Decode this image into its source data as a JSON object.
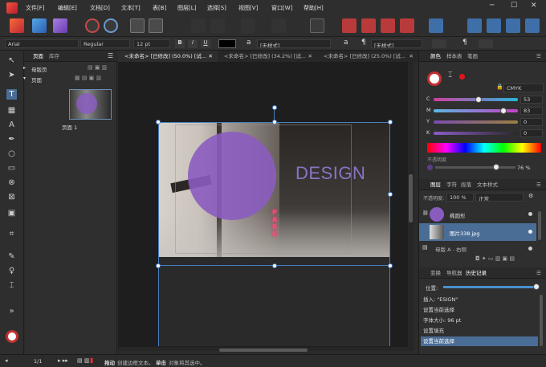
{
  "menu": [
    "文件[F]",
    "编辑[E]",
    "文档[D]",
    "文本[T]",
    "表[B]",
    "图层[L]",
    "选择[S]",
    "视图[V]",
    "窗口[W]",
    "帮助[H]"
  ],
  "context": {
    "font": "Arial",
    "style": "Regular",
    "size": "12 pt",
    "char_style": "[无样式]",
    "para_style": "[无样式]",
    "letter_a": "a",
    "pilcrow": "¶"
  },
  "left_panel": {
    "tab_pages": "页面",
    "tab_library": "库存",
    "master_pages": "母版页",
    "pages": "页面",
    "page_label": "页面 1"
  },
  "doc_tabs": [
    "<未命名> [已修改] (50.0%) [试...",
    "<未命名> [已修改] (34.2%) [试...",
    "<未命名> [已修改] (25.0%) [试..."
  ],
  "canvas": {
    "design_text": "DESIGN",
    "park_text": "PARK"
  },
  "color_panel": {
    "tabs": [
      "颜色",
      "样本表",
      "笔画"
    ],
    "mode": "CMYK",
    "channels": [
      {
        "label": "C",
        "value": 53
      },
      {
        "label": "M",
        "value": 83
      },
      {
        "label": "Y",
        "value": 0
      },
      {
        "label": "K",
        "value": 0
      }
    ],
    "opacity_label": "不透明度",
    "opacity": "76 %"
  },
  "layers_panel": {
    "tabs": [
      "图层",
      "字符",
      "段落",
      "文本样式"
    ],
    "opacity_label": "不透明度:",
    "opacity": "100 %",
    "blend": "正常",
    "layers": [
      {
        "name": "椭圆形",
        "selected": false
      },
      {
        "name": "图片338.jpg",
        "selected": true
      },
      {
        "name": "母版 A - 右侧",
        "selected": false
      }
    ]
  },
  "history_panel": {
    "tabs": [
      "变换",
      "导航器",
      "历史记录"
    ],
    "position_label": "位置:",
    "items": [
      "插入: \"ESIGN\"",
      "设置当前选择",
      "字体大小: 96 pt",
      "设置填充",
      "设置当前选择"
    ],
    "selected_index": 4
  },
  "status": {
    "page": "1/1",
    "hint_bold1": "拖动",
    "hint1": "创建边框文本。",
    "hint_bold2": "单击",
    "hint2": "对象将其选中。"
  },
  "colors": {
    "accent": "#7a5cc4",
    "ellipse": "#8b5cc0",
    "design": "#8a73c6",
    "c": "#27b4d8",
    "m": "#d23fa4",
    "y": "#e0d84a",
    "k": "#606060",
    "selection": "#4a6d96"
  }
}
